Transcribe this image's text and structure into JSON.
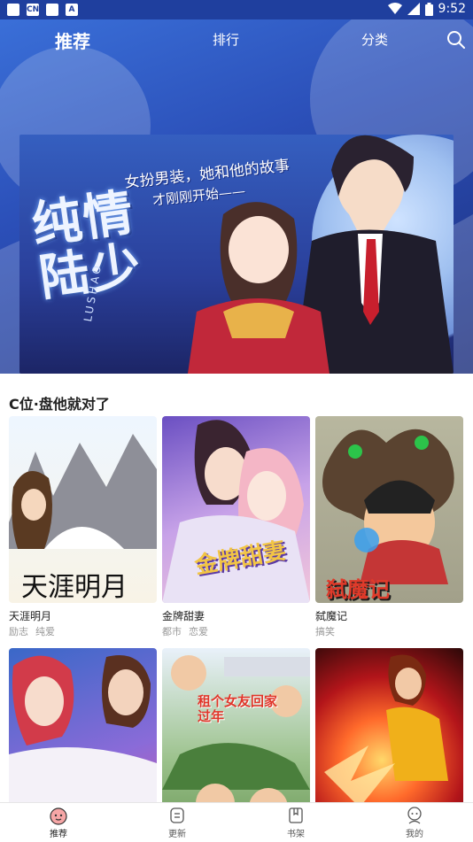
{
  "status_bar": {
    "time": "9:52",
    "icons": [
      "notification-icon",
      "cn-icon",
      "square-icon",
      "a-icon",
      "wifi-icon",
      "signal-icon",
      "battery-icon"
    ],
    "cn_label": "CN",
    "a_label": "A"
  },
  "top_nav": {
    "tabs": [
      {
        "label": "推荐",
        "active": true
      },
      {
        "label": "排行",
        "active": false
      },
      {
        "label": "分类",
        "active": false
      }
    ],
    "search_icon": "search-icon"
  },
  "banner": {
    "title": "纯情陆少",
    "subtitle_line1": "女扮男装，她和他的故事",
    "subtitle_line2": "才刚刚开始——",
    "latin": "LUSHAO",
    "page_count": 9,
    "active_page": 0
  },
  "section": {
    "title": "C位·盘他就对了"
  },
  "cards": [
    {
      "title": "天涯明月",
      "tags": [
        "励志",
        "纯爱"
      ],
      "cover_text": "天涯明月"
    },
    {
      "title": "金牌甜妻",
      "tags": [
        "都市",
        "恋爱"
      ],
      "cover_text": "金牌甜妻"
    },
    {
      "title": "弑魔记",
      "tags": [
        "搞笑"
      ],
      "cover_text": "弑魔记"
    },
    {
      "title": "",
      "tags": [],
      "cover_text": ""
    },
    {
      "title": "",
      "tags": [],
      "cover_text": "租个女友回家过年"
    },
    {
      "title": "",
      "tags": [],
      "cover_text": ""
    }
  ],
  "colors": {
    "accent": "#1f3f9e",
    "tab_active": "#222222"
  },
  "tab_bar": {
    "items": [
      {
        "label": "推荐",
        "icon": "home-icon",
        "active": true
      },
      {
        "label": "更新",
        "icon": "update-icon",
        "active": false
      },
      {
        "label": "书架",
        "icon": "bookshelf-icon",
        "active": false
      },
      {
        "label": "我的",
        "icon": "profile-icon",
        "active": false
      }
    ]
  }
}
